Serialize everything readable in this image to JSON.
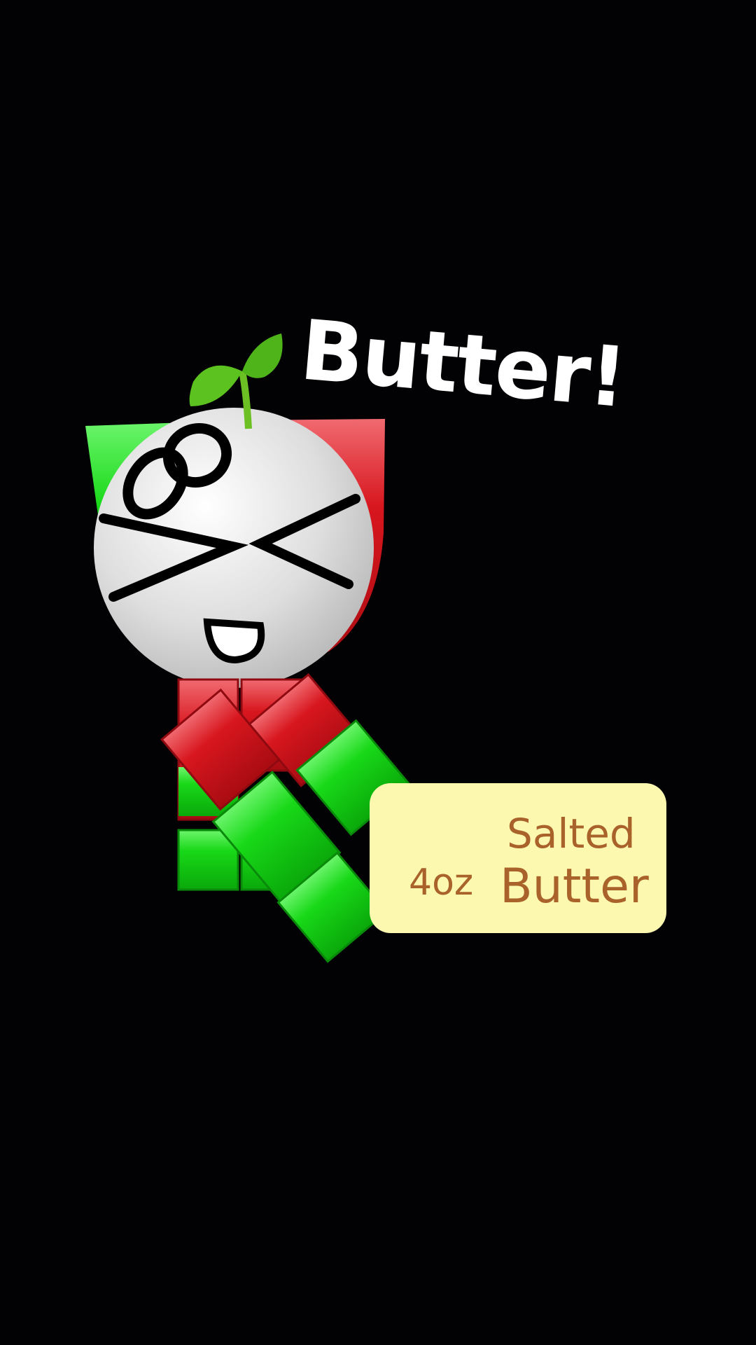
{
  "background_color": "#020204",
  "character": {
    "hat_green": "#1fcc1f",
    "hat_red": "#d9141c",
    "face_color": "#dcdcdc",
    "leaf_color": "#5cc21f",
    "limb_green": "#12d412",
    "limb_red": "#d0141c",
    "expression": "squinting-happy"
  },
  "speech": {
    "text": "Butter!"
  },
  "butter_package": {
    "background": "#fdf8b0",
    "text_color": "#a9622a",
    "line1": "Salted",
    "weight": "4oz",
    "line2": "Butter"
  }
}
